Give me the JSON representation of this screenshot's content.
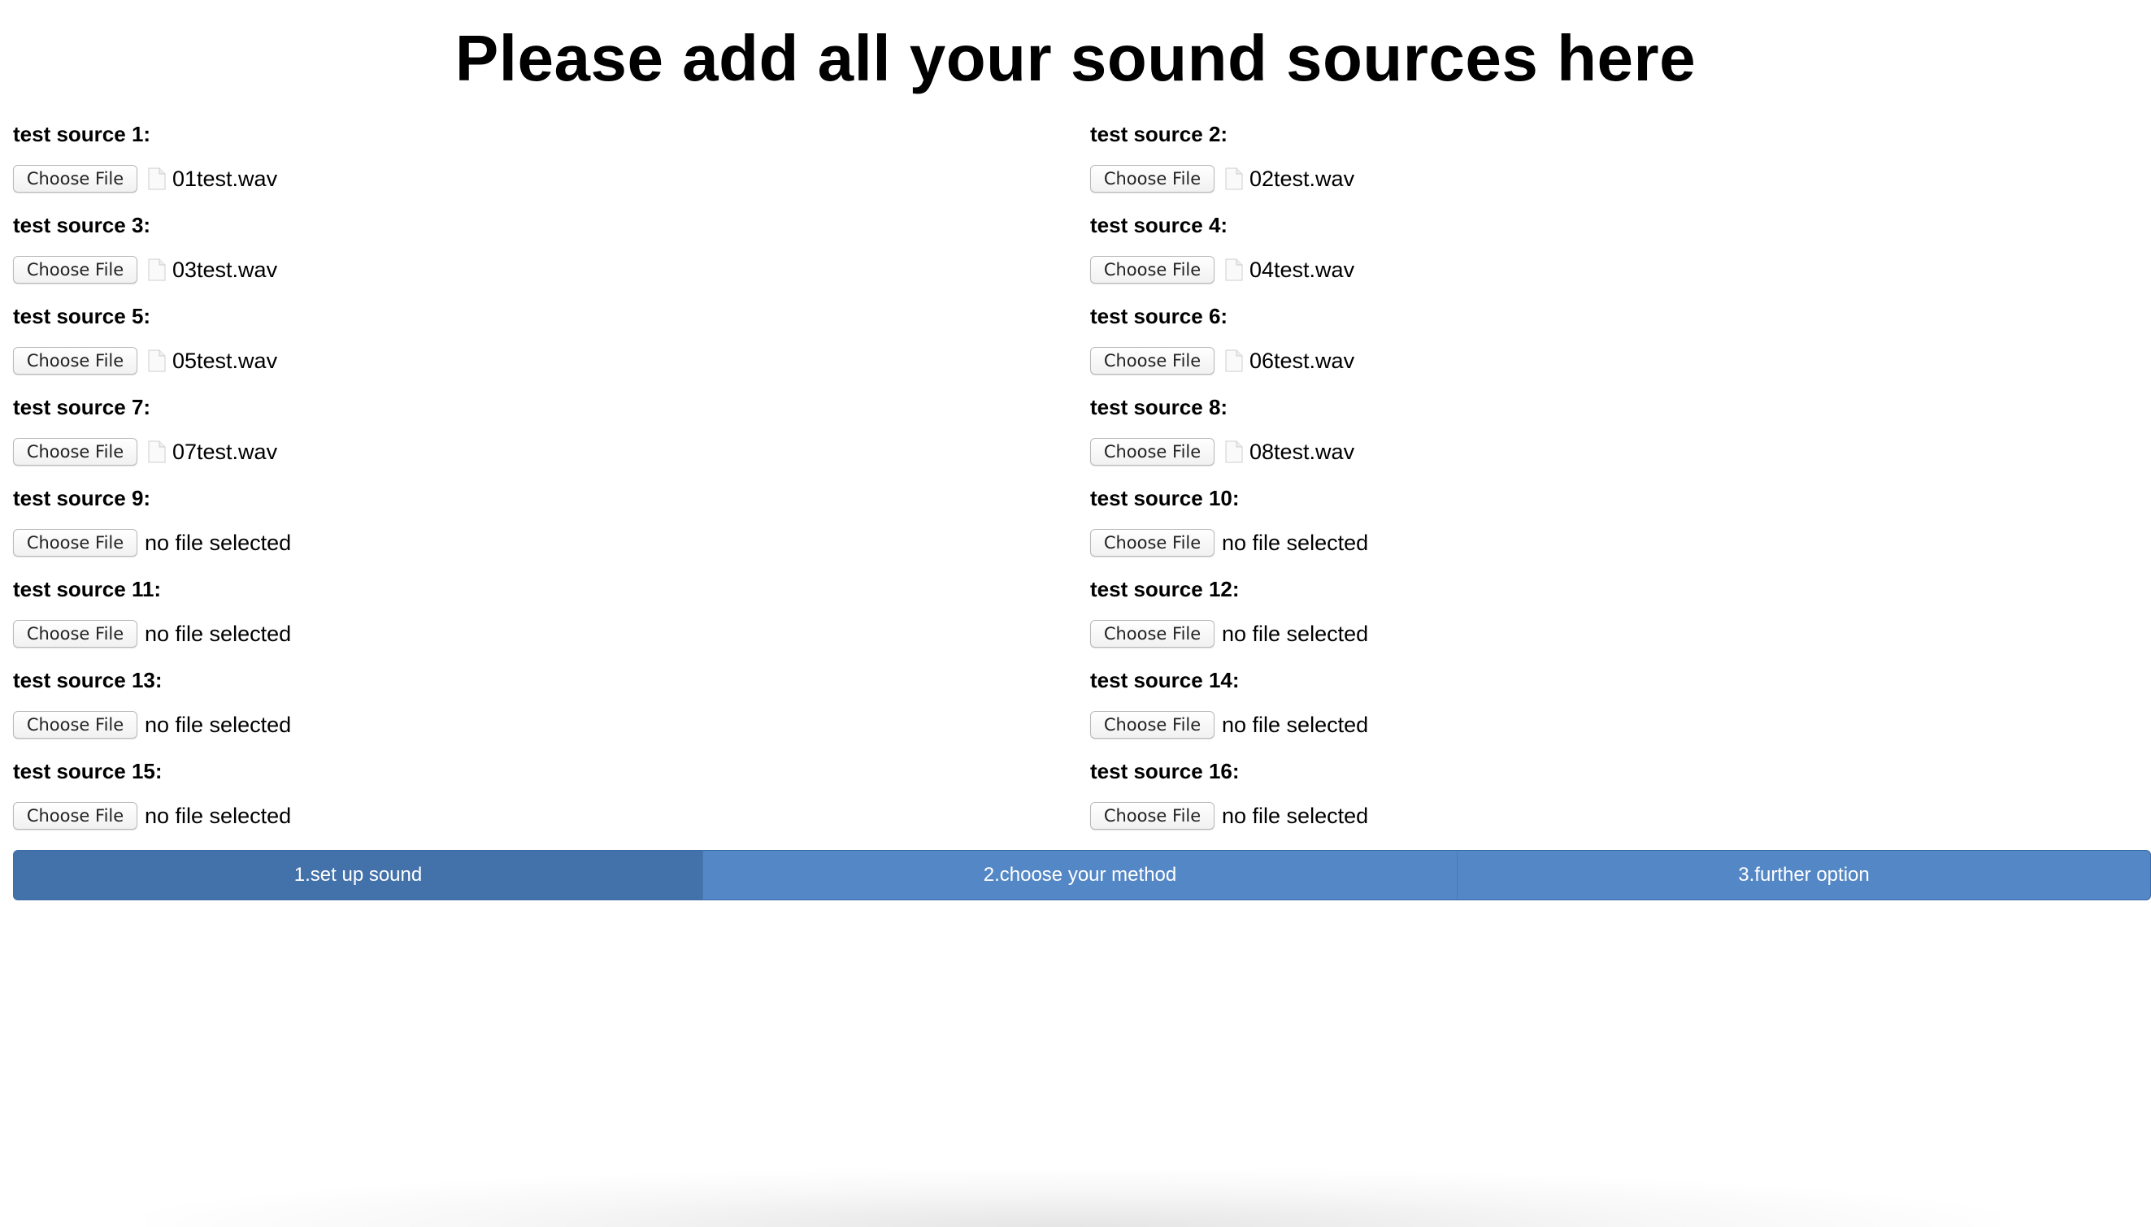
{
  "page": {
    "title": "Please add all your sound sources here"
  },
  "sources": [
    {
      "label": "test source 1:",
      "button": "Choose File",
      "file": "01test.wav",
      "has_file": true
    },
    {
      "label": "test source 2:",
      "button": "Choose File",
      "file": "02test.wav",
      "has_file": true
    },
    {
      "label": "test source 3:",
      "button": "Choose File",
      "file": "03test.wav",
      "has_file": true
    },
    {
      "label": "test source 4:",
      "button": "Choose File",
      "file": "04test.wav",
      "has_file": true
    },
    {
      "label": "test source 5:",
      "button": "Choose File",
      "file": "05test.wav",
      "has_file": true
    },
    {
      "label": "test source 6:",
      "button": "Choose File",
      "file": "06test.wav",
      "has_file": true
    },
    {
      "label": "test source 7:",
      "button": "Choose File",
      "file": "07test.wav",
      "has_file": true
    },
    {
      "label": "test source 8:",
      "button": "Choose File",
      "file": "08test.wav",
      "has_file": true
    },
    {
      "label": "test source 9:",
      "button": "Choose File",
      "file": "no file selected",
      "has_file": false
    },
    {
      "label": "test source 10:",
      "button": "Choose File",
      "file": "no file selected",
      "has_file": false
    },
    {
      "label": "test source 11:",
      "button": "Choose File",
      "file": "no file selected",
      "has_file": false
    },
    {
      "label": "test source 12:",
      "button": "Choose File",
      "file": "no file selected",
      "has_file": false
    },
    {
      "label": "test source 13:",
      "button": "Choose File",
      "file": "no file selected",
      "has_file": false
    },
    {
      "label": "test source 14:",
      "button": "Choose File",
      "file": "no file selected",
      "has_file": false
    },
    {
      "label": "test source 15:",
      "button": "Choose File",
      "file": "no file selected",
      "has_file": false
    },
    {
      "label": "test source 16:",
      "button": "Choose File",
      "file": "no file selected",
      "has_file": false
    }
  ],
  "tabs": [
    {
      "label": "1.set up sound",
      "active": true
    },
    {
      "label": "2.choose your method",
      "active": false
    },
    {
      "label": "3.further option",
      "active": false
    }
  ],
  "colors": {
    "tab_bar": "#5487c6",
    "tab_active": "#4371a9",
    "tab_text": "#ffffff"
  },
  "icons": {
    "file": "file-icon"
  }
}
